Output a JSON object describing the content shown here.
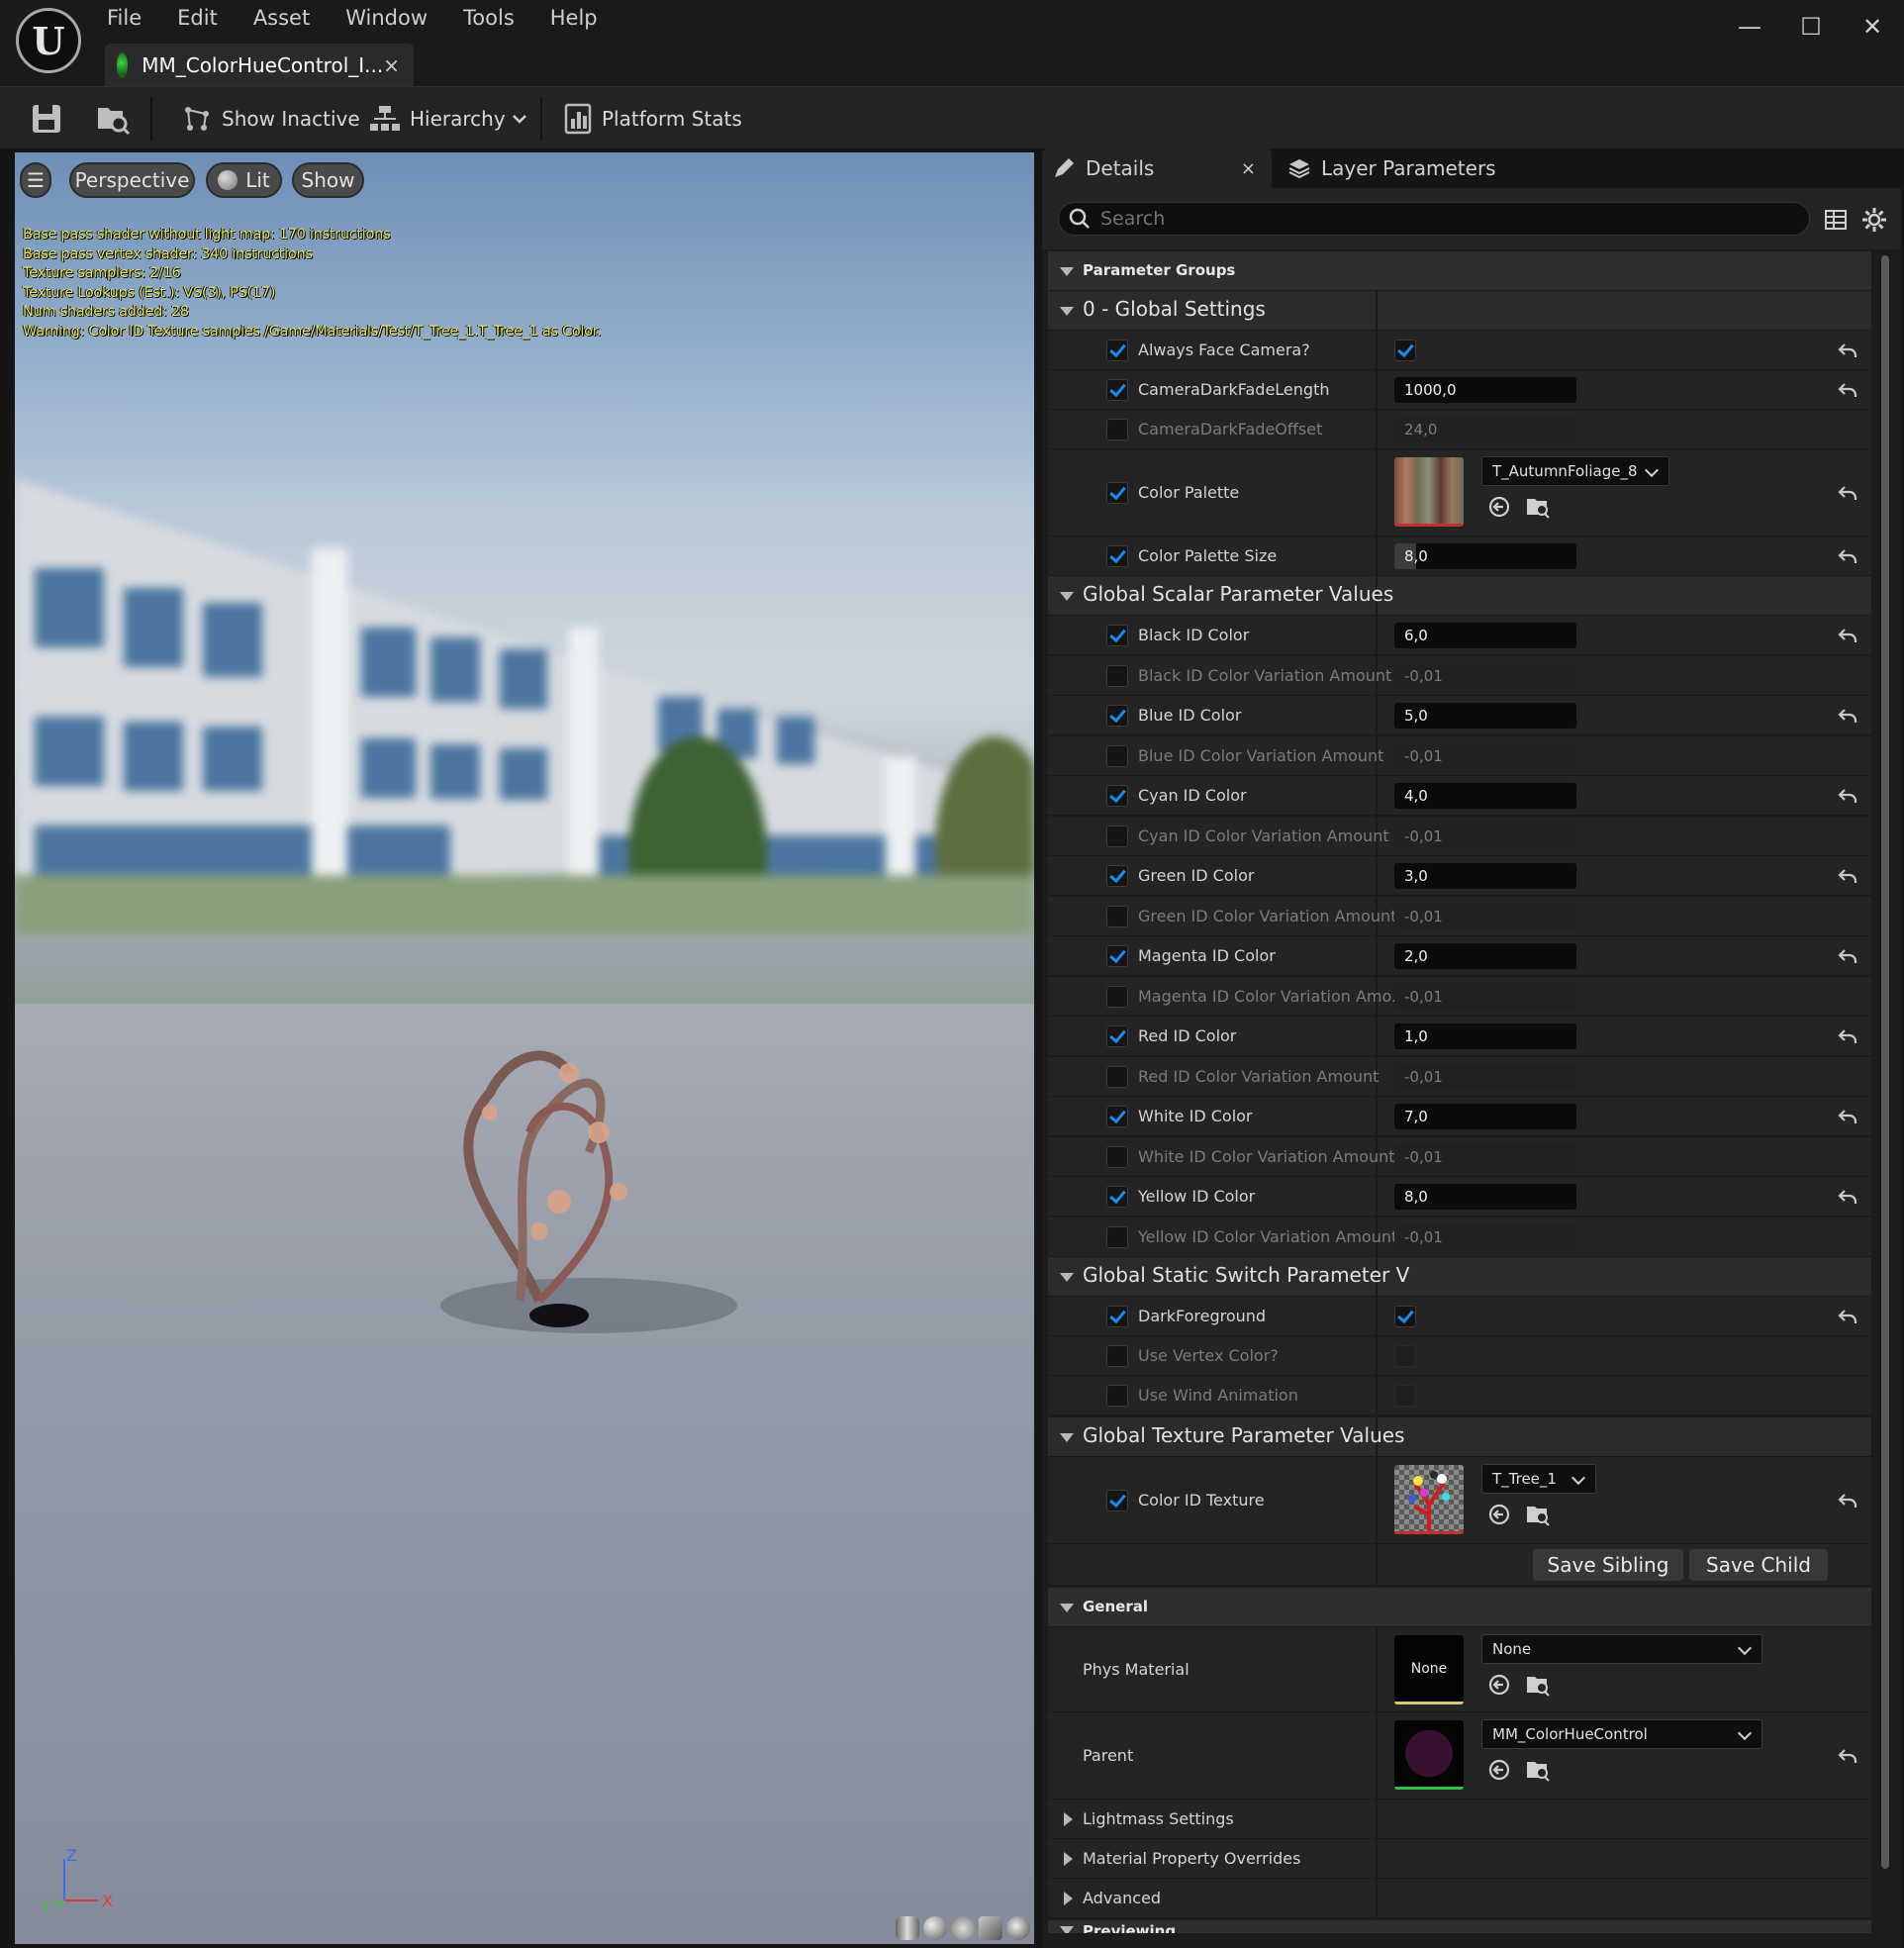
{
  "app": {
    "menu": [
      "File",
      "Edit",
      "Asset",
      "Window",
      "Tools",
      "Help"
    ],
    "doc_tab": "MM_ColorHueControl_I...",
    "tab_close": "×",
    "window_controls": [
      "—",
      "☐",
      "✕"
    ]
  },
  "toolbar": {
    "show_inactive": "Show Inactive",
    "hierarchy": "Hierarchy",
    "platform_stats": "Platform Stats"
  },
  "viewport": {
    "menu_glyph": "☰",
    "perspective": "Perspective",
    "lit": "Lit",
    "show": "Show",
    "stats": [
      "Base pass shader without light map: 170 instructions",
      "Base pass vertex shader: 340 instructions",
      "Texture samplers: 2/16",
      "Texture Lookups (Est.): VS(3), PS(17)",
      "Num shaders added: 28",
      "Warning: Color ID Texture samples /Game/Materials/Test/T_Tree_1.T_Tree_1 as Color."
    ],
    "axis": {
      "z": "Z",
      "y": "Y",
      "x": "X"
    }
  },
  "panel": {
    "details_tab": "Details",
    "details_close": "×",
    "layer_tab": "Layer Parameters",
    "search_placeholder": "Search",
    "parameter_groups": "Parameter Groups",
    "global_settings": "0 - Global Settings",
    "always_face_camera": "Always Face Camera?",
    "camera_dark_fade_length": {
      "label": "CameraDarkFadeLength",
      "value": "1000,0"
    },
    "camera_dark_fade_offset": {
      "label": "CameraDarkFadeOffset",
      "value": "24,0"
    },
    "color_palette": {
      "label": "Color Palette",
      "asset": "T_AutumnFoliage_8"
    },
    "color_palette_size": {
      "label": "Color Palette Size",
      "value": "8,0"
    },
    "scalar_group": "Global Scalar Parameter Values",
    "scalars": [
      {
        "label": "Black ID Color",
        "value": "6,0"
      },
      {
        "label": "Black ID Color Variation Amount",
        "value": "-0,01"
      },
      {
        "label": "Blue ID Color",
        "value": "5,0"
      },
      {
        "label": "Blue ID Color Variation Amount",
        "value": "-0,01"
      },
      {
        "label": "Cyan ID Color",
        "value": "4,0"
      },
      {
        "label": "Cyan ID Color Variation Amount",
        "value": "-0,01"
      },
      {
        "label": "Green ID Color",
        "value": "3,0"
      },
      {
        "label": "Green ID Color Variation Amount",
        "value": "-0,01"
      },
      {
        "label": "Magenta ID Color",
        "value": "2,0"
      },
      {
        "label": "Magenta ID Color Variation Amo...",
        "value": "-0,01"
      },
      {
        "label": "Red ID Color",
        "value": "1,0"
      },
      {
        "label": "Red ID Color Variation Amount",
        "value": "-0,01"
      },
      {
        "label": "White ID Color",
        "value": "7,0"
      },
      {
        "label": "White ID Color Variation Amount",
        "value": "-0,01"
      },
      {
        "label": "Yellow ID Color",
        "value": "8,0"
      },
      {
        "label": "Yellow ID Color Variation Amount",
        "value": "-0,01"
      }
    ],
    "static_switch_group": "Global Static Switch Parameter V",
    "switches": [
      "DarkForeground",
      "Use Vertex Color?",
      "Use Wind Animation"
    ],
    "texture_group": "Global Texture Parameter Values",
    "color_id_texture": {
      "label": "Color ID Texture",
      "asset": "T_Tree_1"
    },
    "save_sibling": "Save Sibling",
    "save_child": "Save Child",
    "general": "General",
    "phys_material": {
      "label": "Phys Material",
      "thumb": "None",
      "value": "None"
    },
    "parent": {
      "label": "Parent",
      "value": "MM_ColorHueControl"
    },
    "lightmass": "Lightmass Settings",
    "overrides": "Material Property Overrides",
    "advanced": "Advanced",
    "previewing": "Previewing"
  },
  "colors": {
    "accent_blue": "#1b8df0",
    "stats_yellow": "#e8e85a",
    "panel_bg": "#242424"
  }
}
